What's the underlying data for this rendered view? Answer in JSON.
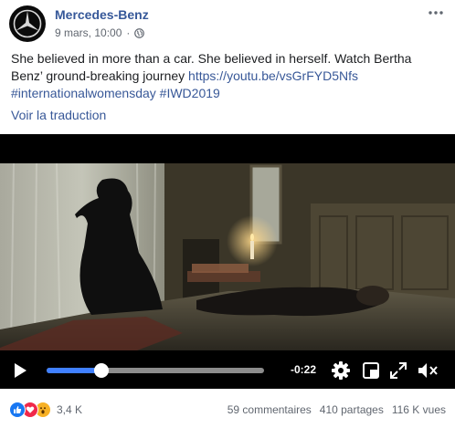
{
  "post": {
    "page_name": "Mercedes-Benz",
    "date": "9 mars, 10:00",
    "separator": "·",
    "text": "She believed in more than a car. She believed in herself. Watch Bertha Benz’ ground-breaking journey ",
    "link": "https://youtu.be/vsGrFYD5Nfs",
    "hashtags": "#internationalwomensday #IWD2019",
    "translate_label": "Voir la traduction"
  },
  "video": {
    "progress": 0.25,
    "time_remaining": "-0:22",
    "accent_color": "#4080ff"
  },
  "footer": {
    "reaction_icons": [
      "like-icon",
      "love-icon",
      "wow-icon"
    ],
    "reaction_count": "3,4 K",
    "comments": "59 commentaires",
    "shares": "410 partages",
    "views": "116 K vues"
  },
  "colors": {
    "link": "#385898",
    "page_name": "#365899",
    "meta": "#616770"
  }
}
